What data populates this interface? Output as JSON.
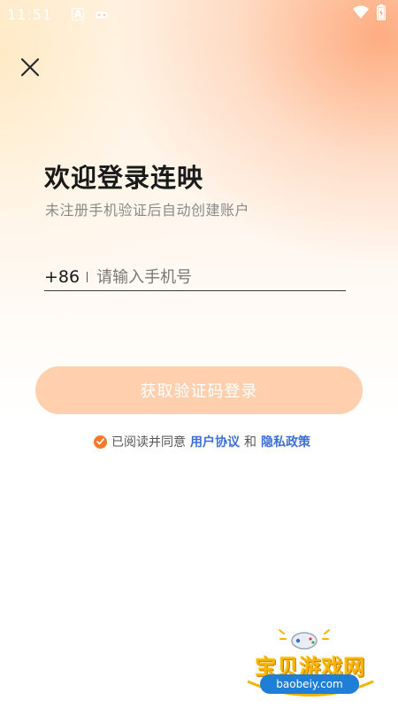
{
  "status_bar": {
    "time": "11:51",
    "indicator": "A",
    "icons": [
      "gamepad-icon",
      "wifi-icon",
      "battery-icon"
    ]
  },
  "close": {
    "icon": "close-icon"
  },
  "title": "欢迎登录连映",
  "subtitle": "未注册手机验证后自动创建账户",
  "phone": {
    "country_code": "+86",
    "value": "",
    "placeholder": "请输入手机号"
  },
  "login_button": {
    "label": "获取验证码登录"
  },
  "agreement": {
    "prefix": "已阅读并同意",
    "terms_label": "用户协议",
    "and": "和",
    "privacy_label": "隐私政策",
    "checked": true
  },
  "watermark": {
    "text": "宝贝游戏网",
    "url": "baobeiy.com"
  },
  "colors": {
    "accent": "#f5792a",
    "button_disabled": "#ffcfae",
    "link": "#3d6fd9",
    "title": "#1a1a1a",
    "subtitle": "#8a8a8a"
  }
}
